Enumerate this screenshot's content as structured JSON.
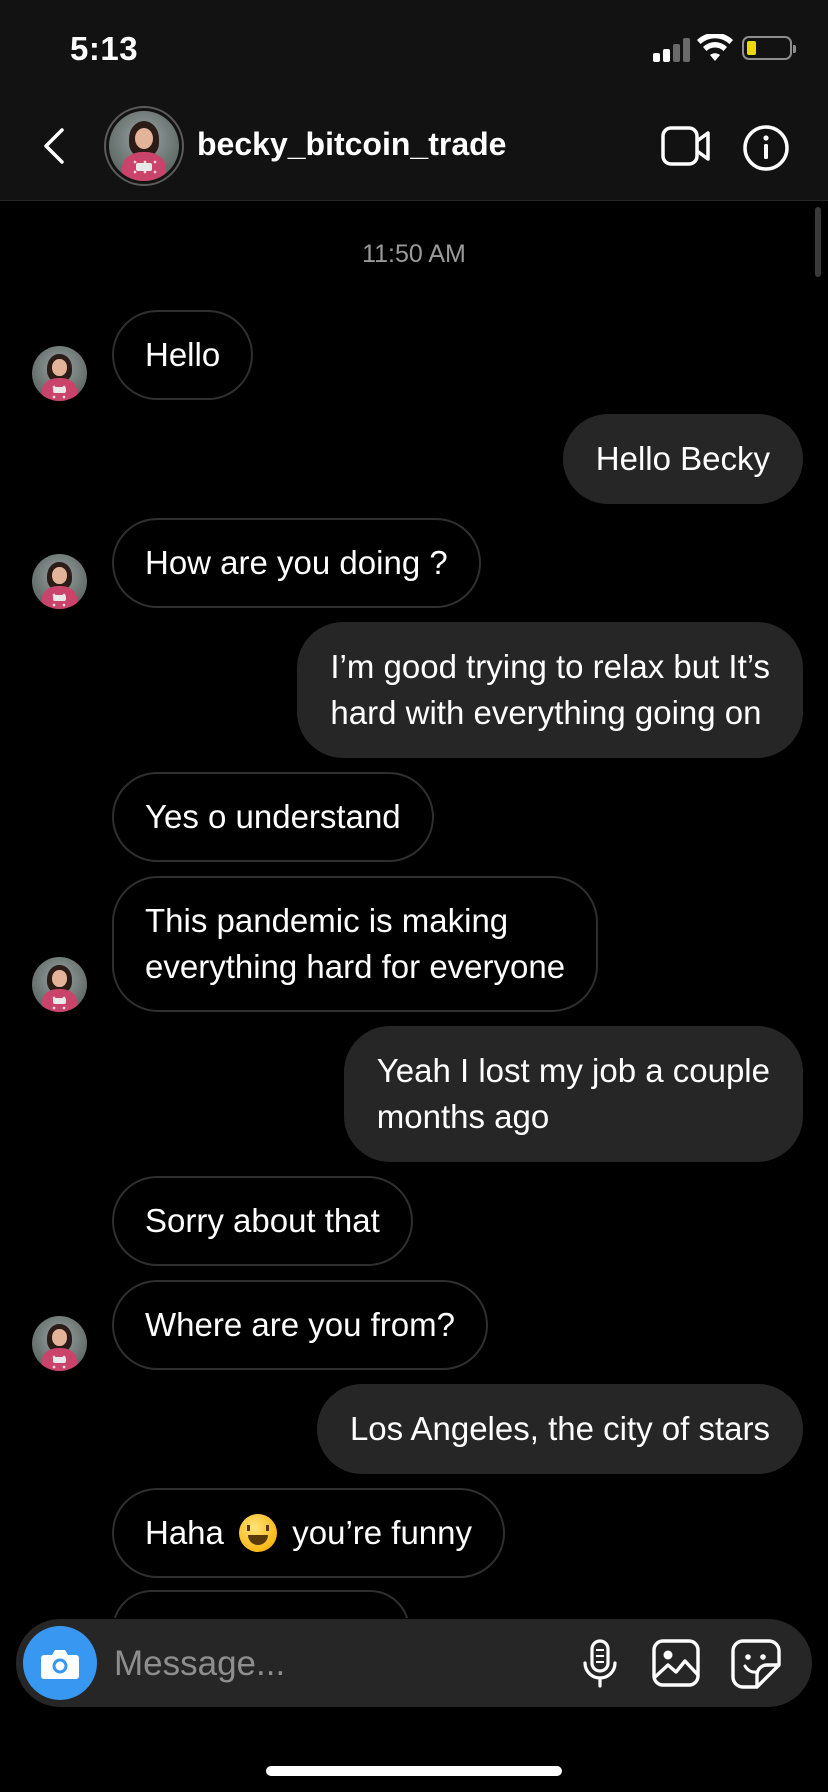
{
  "status_bar": {
    "time": "5:13",
    "battery_level": 0.2
  },
  "header": {
    "username": "becky_bitcoin_trade"
  },
  "chat": {
    "timestamp": "11:50 AM",
    "messages": [
      {
        "side": "in",
        "text": "Hello"
      },
      {
        "side": "out",
        "text": "Hello Becky"
      },
      {
        "side": "in",
        "text": "How are you doing ?"
      },
      {
        "side": "out",
        "lines": [
          "I’m good trying to relax but It’s",
          "hard with everything going on"
        ]
      },
      {
        "side": "in",
        "text": "Yes o understand"
      },
      {
        "side": "in",
        "lines": [
          "This pandemic is making",
          "everything hard for everyone"
        ]
      },
      {
        "side": "out",
        "lines": [
          "Yeah I lost my job a couple",
          "months ago"
        ]
      },
      {
        "side": "in",
        "text": "Sorry about that"
      },
      {
        "side": "in",
        "text": "Where are you from?"
      },
      {
        "side": "out",
        "text": "Los Angeles, the city of stars"
      },
      {
        "side": "in",
        "text_before_emoji": "Haha",
        "emoji": "grinning-squinting-face",
        "text_after_emoji": "you’re funny"
      }
    ]
  },
  "composer": {
    "placeholder": "Message..."
  },
  "colors": {
    "accent": "#3897f0",
    "outgoing_bubble": "#262626",
    "background": "#000000"
  }
}
